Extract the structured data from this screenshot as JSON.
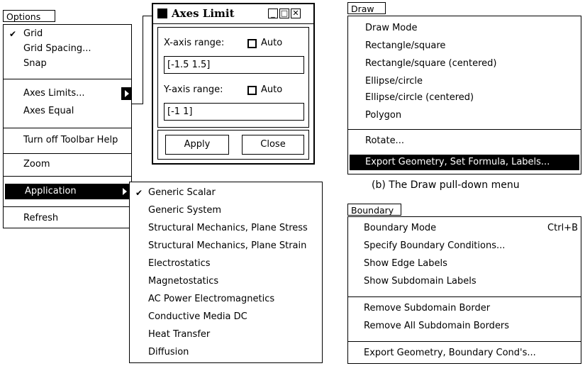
{
  "options_menu": {
    "title": "Options",
    "items": [
      "Grid",
      "Grid Spacing...",
      "Snap",
      "Axes Limits...",
      "Axes Equal",
      "Turn off Toolbar Help",
      "Zoom",
      "Application",
      "Refresh"
    ],
    "checked": "Grid",
    "highlighted": "Application"
  },
  "axes_dialog": {
    "title": "Axes Limit",
    "x_label": "X-axis range:",
    "x_auto": "Auto",
    "x_value": "[-1.5 1.5]",
    "y_label": "Y-axis range:",
    "y_auto": "Auto",
    "y_value": "[-1 1]",
    "apply": "Apply",
    "close": "Close"
  },
  "application_submenu": {
    "items": [
      "Generic Scalar",
      "Generic System",
      "Structural Mechanics, Plane Stress",
      "Structural Mechanics, Plane Strain",
      "Electrostatics",
      "Magnetostatics",
      "AC Power Electromagnetics",
      "Conductive Media DC",
      "Heat Transfer",
      "Diffusion"
    ],
    "checked": "Generic Scalar"
  },
  "draw_menu": {
    "title": "Draw",
    "items": [
      "Draw Mode",
      "Rectangle/square",
      "Rectangle/square (centered)",
      "Ellipse/circle",
      "Ellipse/circle (centered)",
      "Polygon",
      "Rotate...",
      "Export Geometry, Set Formula, Labels..."
    ],
    "highlighted": "Export Geometry, Set Formula, Labels...",
    "caption": "(b) The Draw pull-down menu"
  },
  "boundary_menu": {
    "title": "Boundary",
    "items": [
      "Boundary Mode",
      "Specify Boundary Conditions...",
      "Show Edge Labels",
      "Show Subdomain Labels",
      "Remove Subdomain Border",
      "Remove All Subdomain Borders",
      "Export Geometry, Boundary Cond's..."
    ],
    "shortcut": "Ctrl+B"
  }
}
